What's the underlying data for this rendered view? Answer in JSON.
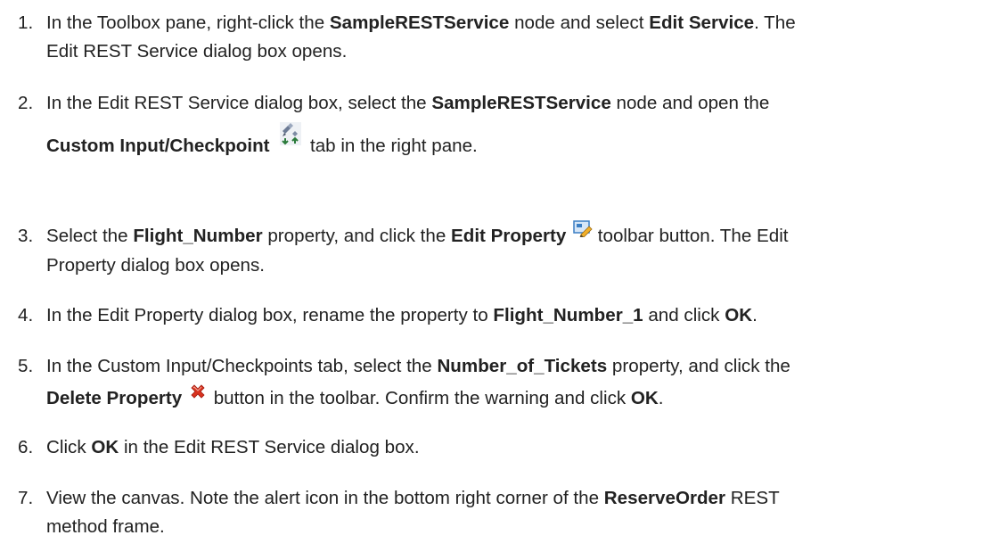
{
  "steps": [
    {
      "number": "1.",
      "t1": "In the Toolbox pane, right-click the ",
      "b1": "SampleRESTService",
      "t2": " node and select ",
      "b2": "Edit Service",
      "t3": ". The",
      "line2": "Edit REST Service dialog box opens."
    },
    {
      "number": "2.",
      "t1": "In the Edit REST Service dialog box, select the ",
      "b1": "SampleRESTService",
      "t2": " node and open the",
      "b2": "Custom Input/Checkpoint",
      "t3": " tab in the right pane.",
      "icon": "custom-input-checkpoint-icon"
    },
    {
      "number": "3.",
      "t1": "Select the ",
      "b1": "Flight_Number",
      "t2": " property, and click the ",
      "b2": "Edit Property",
      "t3": " toolbar button. The Edit",
      "line2": "Property dialog box opens.",
      "icon": "edit-property-icon"
    },
    {
      "number": "4.",
      "t1": "In the Edit Property dialog box, rename the property to ",
      "b1": "Flight_Number_1",
      "t2": " and click ",
      "b2": "OK",
      "t3": "."
    },
    {
      "number": "5.",
      "t1": "In the Custom Input/Checkpoints tab, select the ",
      "b1": "Number_of_Tickets",
      "t2": " property, and click the",
      "b2": "Delete Property",
      "t3": " button in the toolbar. Confirm the warning and click ",
      "b3": "OK",
      "t4": ".",
      "icon": "delete-property-icon"
    },
    {
      "number": "6.",
      "t1": "Click ",
      "b1": "OK",
      "t2": " in the Edit REST Service dialog box."
    },
    {
      "number": "7.",
      "t1": "View the canvas. Note the alert icon in the bottom right corner of the ",
      "b1": "ReserveOrder",
      "t2": " REST",
      "line2": "method frame."
    }
  ],
  "colors": {
    "text": "#222222",
    "delete_icon": "#d9331f",
    "edit_icon": "#3b7fc4"
  }
}
